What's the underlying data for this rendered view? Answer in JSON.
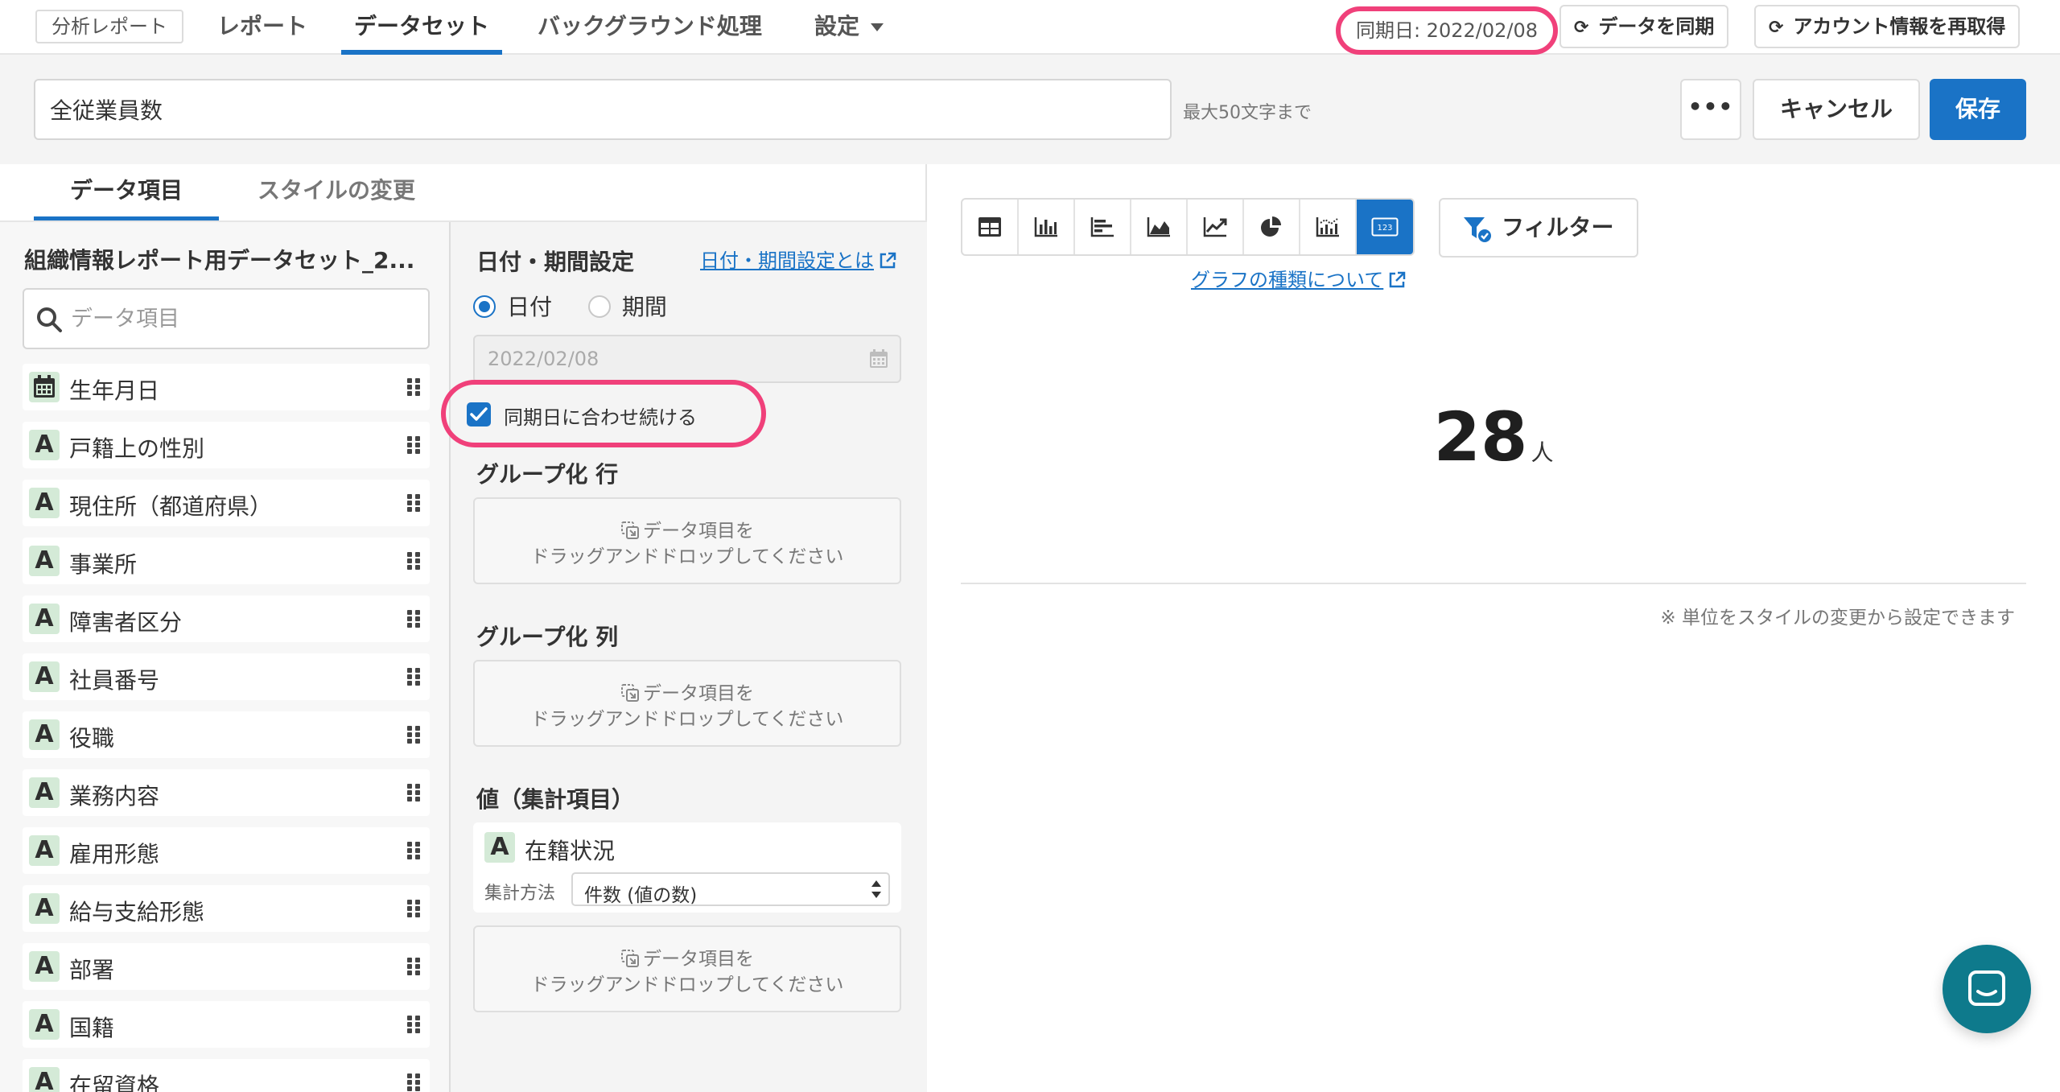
{
  "topnav": {
    "app_badge": "分析レポート",
    "tabs": [
      {
        "label": "レポート"
      },
      {
        "label": "データセット"
      },
      {
        "label": "バックグラウンド処理"
      },
      {
        "label": "設定"
      }
    ],
    "sync_date": "同期日: 2022/02/08",
    "sync_button": "データを同期",
    "refetch_button": "アカウント情報を再取得"
  },
  "titlebar": {
    "dataset_title": "全従業員数",
    "hint": "最大50文字まで",
    "more_label": "•••",
    "cancel_label": "キャンセル",
    "save_label": "保存"
  },
  "subtabs": [
    {
      "label": "データ項目"
    },
    {
      "label": "スタイルの変更"
    }
  ],
  "fields_panel": {
    "dataset_name": "組織情報レポート用データセット_2...",
    "search_placeholder": "データ項目",
    "items": [
      {
        "label": "生年月日",
        "type": "date"
      },
      {
        "label": "戸籍上の性別",
        "type": "A"
      },
      {
        "label": "現住所（都道府県）",
        "type": "A"
      },
      {
        "label": "事業所",
        "type": "A"
      },
      {
        "label": "障害者区分",
        "type": "A"
      },
      {
        "label": "社員番号",
        "type": "A"
      },
      {
        "label": "役職",
        "type": "A"
      },
      {
        "label": "業務内容",
        "type": "A"
      },
      {
        "label": "雇用形態",
        "type": "A"
      },
      {
        "label": "給与支給形態",
        "type": "A"
      },
      {
        "label": "部署",
        "type": "A"
      },
      {
        "label": "国籍",
        "type": "A"
      },
      {
        "label": "在留資格",
        "type": "A"
      }
    ]
  },
  "settings_panel": {
    "date_section_title": "日付・期間設定",
    "date_help_link": "日付・期間設定とは",
    "radio_date": "日付",
    "radio_period": "期間",
    "date_value": "2022/02/08",
    "keep_sync_label": "同期日に合わせ続ける",
    "group_row_title": "グループ化 行",
    "group_col_title": "グループ化 列",
    "values_title": "値（集計項目）",
    "drop_line1": "データ項目を",
    "drop_line2": "ドラッグアンドドロップしてください",
    "value_item": {
      "type": "A",
      "name": "在籍状況"
    },
    "agg_label": "集計方法",
    "agg_value": "件数 (値の数)"
  },
  "chart_panel": {
    "chart_types": [
      "table-icon",
      "column-chart-icon",
      "bar-chart-icon",
      "area-chart-icon",
      "line-chart-icon",
      "pie-chart-icon",
      "combo-chart-icon",
      "number-icon"
    ],
    "active_chart_type": "number-icon",
    "number_icon_text": "123",
    "filter_label": "フィルター",
    "graph_help_link": "グラフの種類について",
    "result_value": "28",
    "result_unit": "人",
    "unit_note": "※ 単位をスタイルの変更から設定できます"
  },
  "colors": {
    "accent": "#1a73c6",
    "highlight": "#f0407a",
    "type_badge": "#d4ead7",
    "chat": "#0e7a8c"
  }
}
